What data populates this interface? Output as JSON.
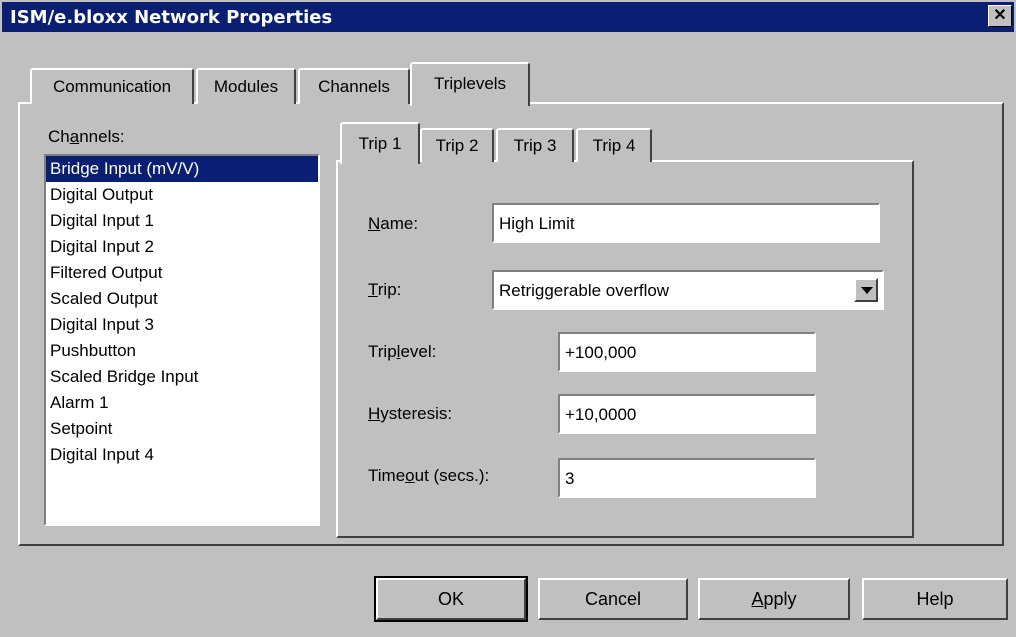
{
  "window": {
    "title": "ISM/e.bloxx Network Properties",
    "close_glyph": "✕"
  },
  "tabs": [
    {
      "label": "Communication",
      "active": false
    },
    {
      "label": "Modules",
      "active": false
    },
    {
      "label": "Channels",
      "active": false
    },
    {
      "label": "Triplevels",
      "active": true
    }
  ],
  "channels": {
    "label_pre": "Ch",
    "label_u": "a",
    "label_post": "nnels:",
    "items": [
      "Bridge Input (mV/V)",
      "Digital Output",
      "Digital Input 1",
      "Digital Input 2",
      "Filtered Output",
      "Scaled Output",
      "Digital Input 3",
      "Pushbutton",
      "Scaled Bridge Input",
      "Alarm 1",
      "Setpoint",
      "Digital Input 4"
    ],
    "selected_index": 0
  },
  "trip_tabs": [
    {
      "label": "Trip 1",
      "active": true
    },
    {
      "label": "Trip 2",
      "active": false
    },
    {
      "label": "Trip 3",
      "active": false
    },
    {
      "label": "Trip 4",
      "active": false
    }
  ],
  "form": {
    "name_u": "N",
    "name_post": "ame:",
    "name_value": "High Limit",
    "trip_u": "T",
    "trip_post": "rip:",
    "trip_value": "Retriggerable overflow",
    "triplevel_pre": "Trip",
    "triplevel_u": "l",
    "triplevel_post": "evel:",
    "triplevel_value": "+100,000",
    "hysteresis_u": "H",
    "hysteresis_post": "ysteresis:",
    "hysteresis_value": "+10,0000",
    "timeout_pre": "Time",
    "timeout_u": "o",
    "timeout_post": "ut (secs.):",
    "timeout_value": "3"
  },
  "buttons": {
    "ok": "OK",
    "cancel": "Cancel",
    "apply_u": "A",
    "apply_post": "pply",
    "help": "Help"
  }
}
